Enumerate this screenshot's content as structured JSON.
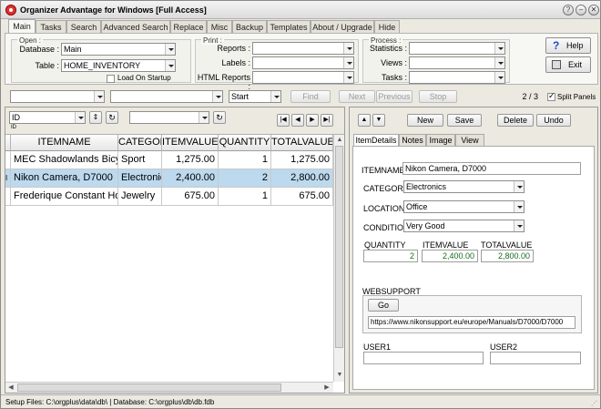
{
  "window": {
    "title": "Organizer Advantage for Windows [Full Access]",
    "controls": [
      "?",
      "–",
      "✕"
    ]
  },
  "tabs": [
    "Main",
    "Tasks",
    "Search",
    "Advanced Search",
    "Replace",
    "Misc",
    "Backup",
    "Templates",
    "About / Upgrade",
    "Hide"
  ],
  "open_group": {
    "title": "Open :",
    "database_label": "Database :",
    "database_value": "Main",
    "table_label": "Table :",
    "table_value": "HOME_INVENTORY",
    "load_on_startup": "Load On Startup"
  },
  "print_group": {
    "title": "Print :",
    "reports_label": "Reports :",
    "labels_label": "Labels :",
    "html_reports_label": "HTML Reports :"
  },
  "process_group": {
    "title": "Process :",
    "statistics_label": "Statistics :",
    "views_label": "Views :",
    "tasks_label": "Tasks :"
  },
  "help_button": "Help",
  "exit_button": "Exit",
  "search_bar": {
    "mode_value": "Start",
    "find": "Find",
    "next": "Next",
    "previous": "Previous",
    "stop": "Stop",
    "record_position": "2 / 3",
    "split_panels": "Split Panels"
  },
  "grid_toolbar": {
    "sort_field": "ID",
    "sort_field_caption": "ID"
  },
  "grid": {
    "columns": [
      "ITEMNAME",
      "CATEGORY",
      "ITEMVALUE",
      "QUANTITY",
      "TOTALVALUE"
    ],
    "rows": [
      {
        "itemname": "MEC Shadowlands Bicycle",
        "category": "Sport",
        "itemvalue": "1,275.00",
        "quantity": "1",
        "totalvalue": "1,275.00"
      },
      {
        "itemname": "Nikon Camera, D7000",
        "category": "Electronics",
        "itemvalue": "2,400.00",
        "quantity": "2",
        "totalvalue": "2,800.00"
      },
      {
        "itemname": "Frederique Constant Horological",
        "category": "Jewelry",
        "itemvalue": "675.00",
        "quantity": "1",
        "totalvalue": "675.00"
      }
    ],
    "selected_row_marker": "I"
  },
  "record_buttons": {
    "new": "New",
    "save": "Save",
    "delete": "Delete",
    "undo": "Undo"
  },
  "detail_tabs": [
    "ItemDetails",
    "Notes",
    "Image",
    "View"
  ],
  "detail": {
    "itemname_label": "ITEMNAME",
    "itemname_value": "Nikon Camera, D7000",
    "category_label": "CATEGORY",
    "category_value": "Electronics",
    "location_label": "LOCATION",
    "location_value": "Office",
    "condition_label": "CONDITION",
    "condition_value": "Very Good",
    "quantity_label": "QUANTITY",
    "quantity_value": "2",
    "itemvalue_label": "ITEMVALUE",
    "itemvalue_value": "2,400.00",
    "totalvalue_label": "TOTALVALUE",
    "totalvalue_value": "2,800.00",
    "websupport_label": "WEBSUPPORT",
    "go_button": "Go",
    "websupport_value": "https://www.nikonsupport.eu/europe/Manuals/D7000/D7000",
    "user1_label": "USER1",
    "user2_label": "USER2"
  },
  "status_bar": "Setup Files: C:\\orgplus\\data\\db\\ | Database: C:\\orgplus\\db\\db.fdb"
}
